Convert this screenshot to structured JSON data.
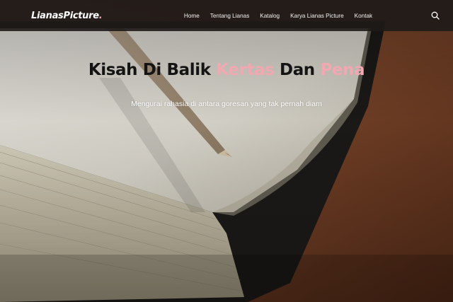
{
  "brand": {
    "name": "LianasPicture",
    "dot": "."
  },
  "nav": {
    "items": [
      "Home",
      "Tentang Lianas",
      "Katalog",
      "Karya Lianas Picture",
      "Kontak"
    ]
  },
  "icons": {
    "search": "search-icon"
  },
  "hero": {
    "title_parts": [
      {
        "text": "Kisah Di Balik ",
        "accent": false
      },
      {
        "text": "Kertas",
        "accent": true
      },
      {
        "text": " Dan ",
        "accent": false
      },
      {
        "text": "Pena",
        "accent": true
      }
    ],
    "subtitle": "Mengurai rahasia di antara goresan yang tak pernah diam"
  },
  "colors": {
    "accent": "#f1a8b1",
    "navbar_bg": "#1e1a18",
    "title_text": "#141414"
  }
}
